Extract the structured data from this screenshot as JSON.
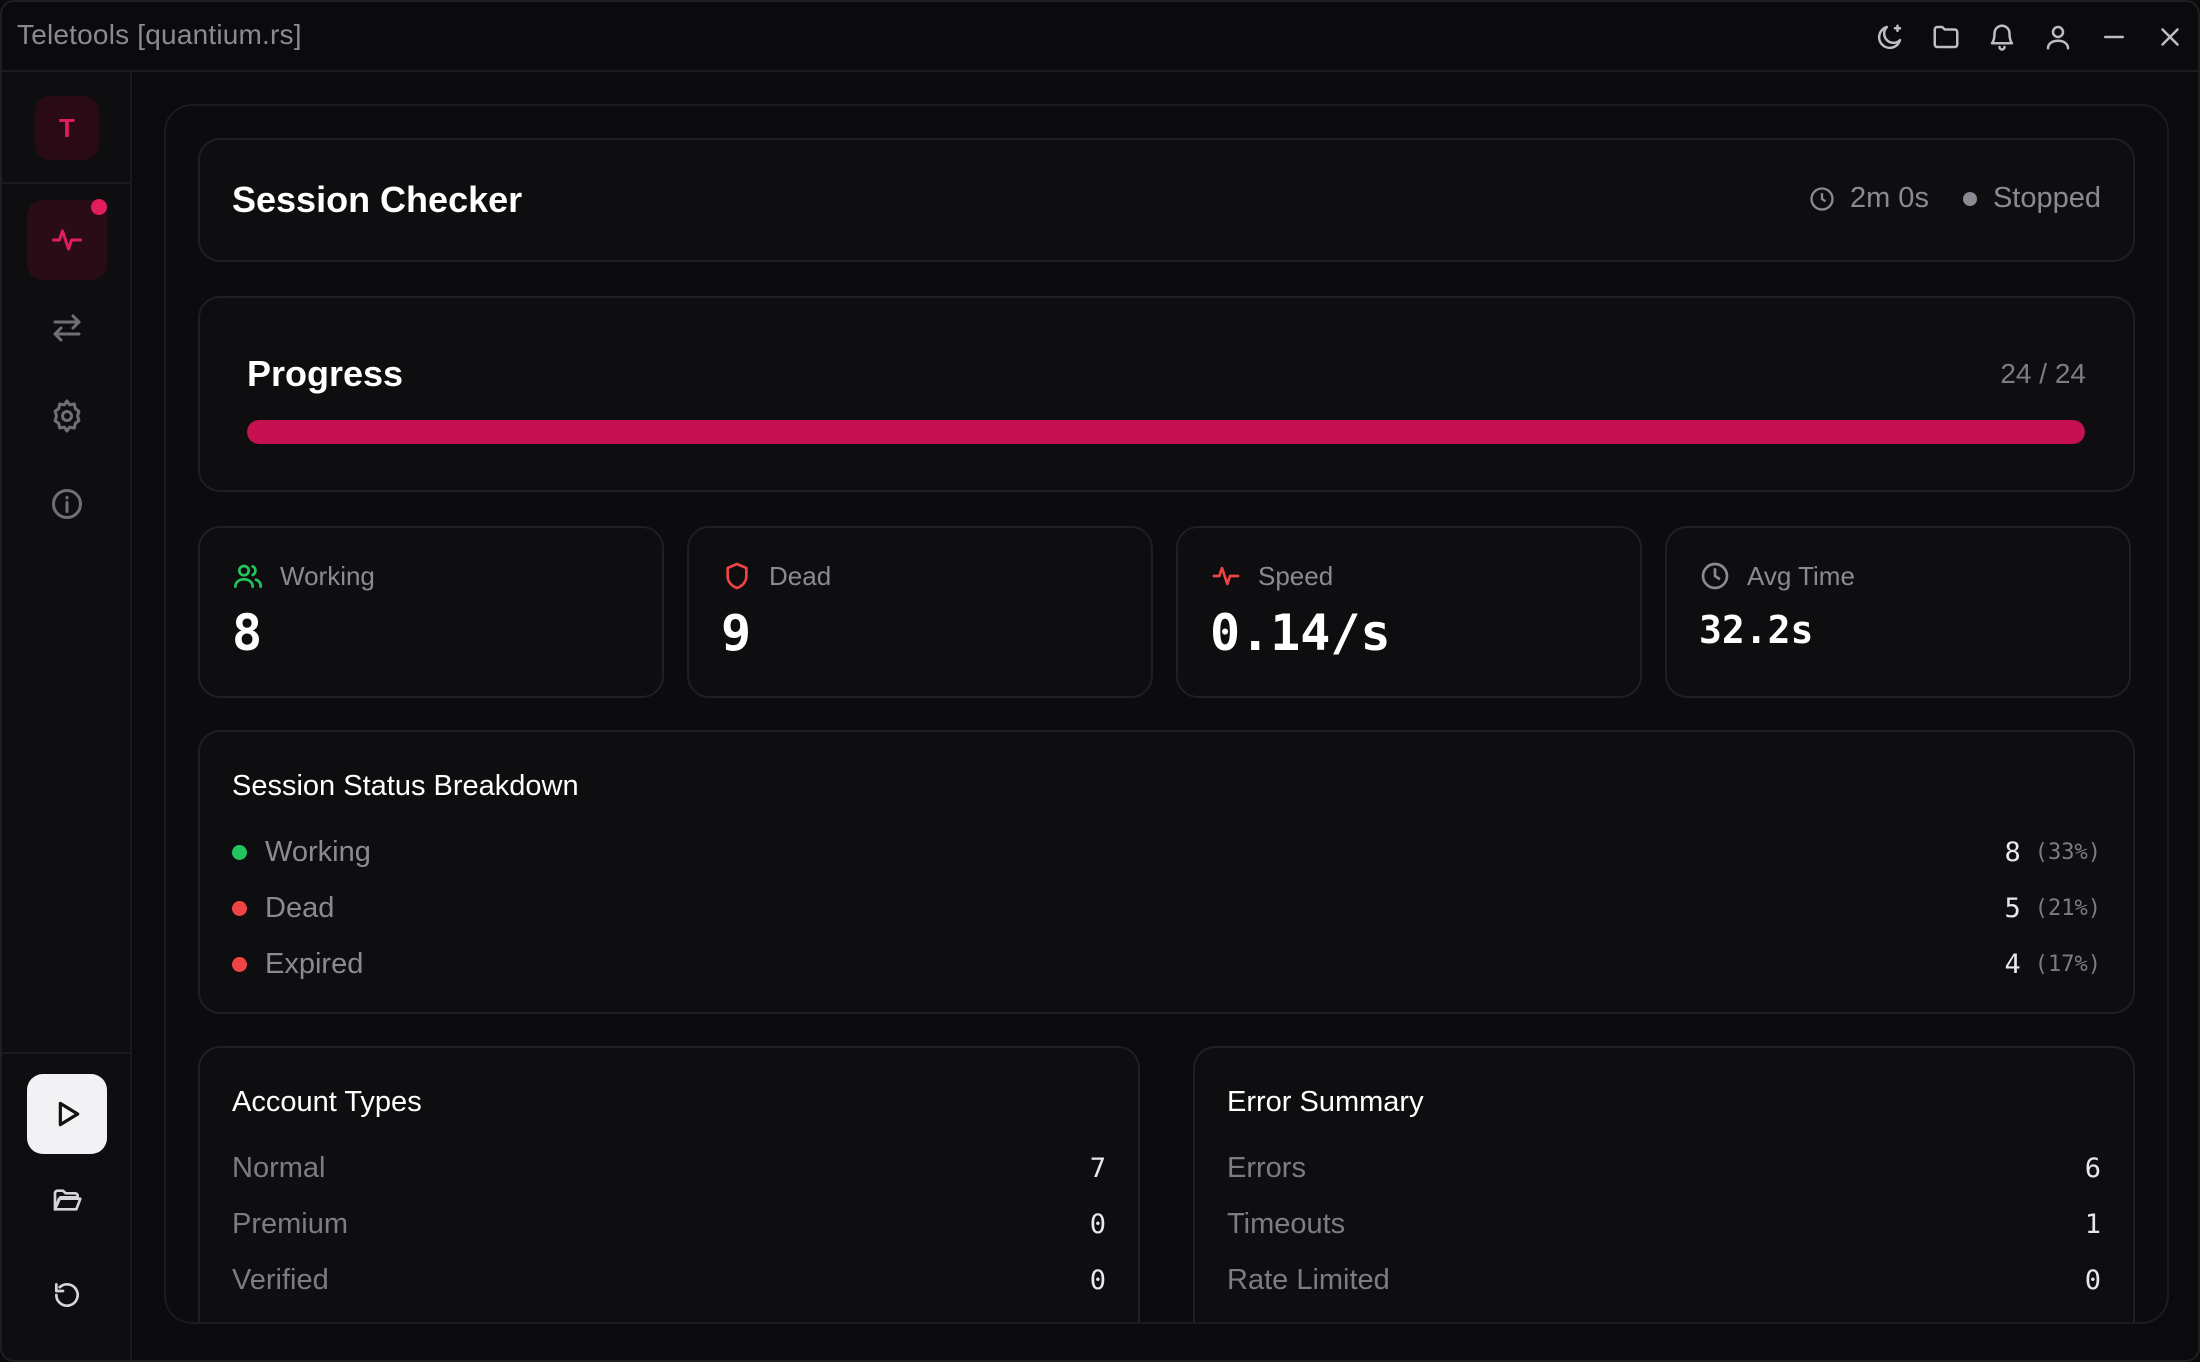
{
  "window": {
    "title": "Teletools [quantium.rs]"
  },
  "titlebar": {
    "icons": [
      "theme-icon",
      "folder-icon",
      "bell-icon",
      "user-icon",
      "minimize-icon",
      "close-icon"
    ]
  },
  "sidebar": {
    "avatar_letter": "T",
    "nav": [
      "activity-icon",
      "transfer-icon",
      "gear-icon",
      "info-icon"
    ],
    "bottom": [
      "play-icon",
      "folder-open-icon",
      "reset-icon"
    ]
  },
  "header": {
    "title": "Session Checker",
    "elapsed": "2m 0s",
    "status": "Stopped"
  },
  "progress": {
    "title": "Progress",
    "count": "24 / 24",
    "fraction": 1.0
  },
  "stats": [
    {
      "label": "Working",
      "value": "8",
      "icon": "users-icon",
      "color": "#22c55e"
    },
    {
      "label": "Dead",
      "value": "9",
      "icon": "shield-icon",
      "color": "#ef4444"
    },
    {
      "label": "Speed",
      "value": "0.14/s",
      "icon": "activity-icon",
      "color": "#ef4444"
    },
    {
      "label": "Avg Time",
      "value": "32.2s",
      "icon": "clock-icon",
      "color": "#8a8a92"
    }
  ],
  "breakdown": {
    "title": "Session Status Breakdown",
    "rows": [
      {
        "label": "Working",
        "count": "8",
        "pct": "(33%)",
        "color": "#22c55e"
      },
      {
        "label": "Dead",
        "count": "5",
        "pct": "(21%)",
        "color": "#ef4444"
      },
      {
        "label": "Expired",
        "count": "4",
        "pct": "(17%)",
        "color": "#ef4444"
      }
    ]
  },
  "account_types": {
    "title": "Account Types",
    "rows": [
      {
        "label": "Normal",
        "value": "7"
      },
      {
        "label": "Premium",
        "value": "0"
      },
      {
        "label": "Verified",
        "value": "0"
      }
    ]
  },
  "error_summary": {
    "title": "Error Summary",
    "rows": [
      {
        "label": "Errors",
        "value": "6"
      },
      {
        "label": "Timeouts",
        "value": "1"
      },
      {
        "label": "Rate Limited",
        "value": "0"
      }
    ]
  },
  "colors": {
    "accent": "#e11d5c",
    "progress_fill": "#c5114f",
    "working": "#22c55e",
    "dead": "#ef4444"
  }
}
